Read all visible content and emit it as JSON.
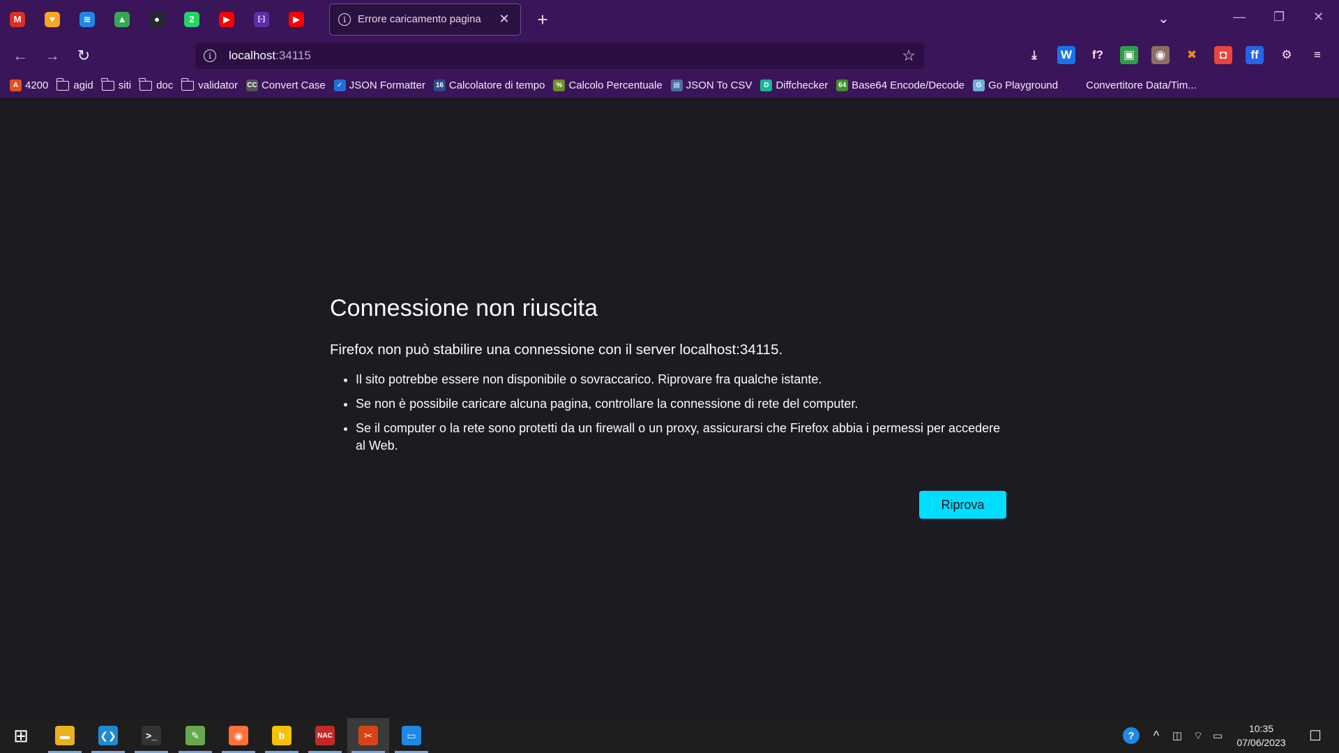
{
  "browser": {
    "pinned_tabs": [
      {
        "name": "gmail-icon",
        "glyph": "M",
        "color": "#d93025"
      },
      {
        "name": "shield-fox-icon",
        "glyph": "♥",
        "color": "#f5a623"
      },
      {
        "name": "layers-icon",
        "glyph": "≋",
        "color": "#1e88e5"
      },
      {
        "name": "drive-icon",
        "glyph": "▲",
        "color": "#34a853"
      },
      {
        "name": "github-icon",
        "glyph": "●",
        "color": "#24292f"
      },
      {
        "name": "whatsapp-icon",
        "glyph": "2",
        "color": "#25d366"
      },
      {
        "name": "youtube-icon",
        "glyph": "▶",
        "color": "#ff0000"
      },
      {
        "name": "brackets-icon",
        "glyph": "[-]",
        "color": "#5b2ea6"
      },
      {
        "name": "youtube-icon",
        "glyph": "▶",
        "color": "#ff0000"
      }
    ],
    "active_tab": {
      "title": "Errore caricamento pagina",
      "close": "✕"
    },
    "new_tab": "+",
    "tabs_list": "⌄",
    "window_controls": {
      "minimize": "—",
      "restore": "❐",
      "close": "✕"
    },
    "nav": {
      "back": "←",
      "forward": "→",
      "reload": "↻"
    },
    "url": {
      "host": "localhost",
      "port": ":34115",
      "bookmark_star": "☆"
    },
    "toolbar_icons": [
      {
        "name": "download-icon",
        "glyph": "⤓",
        "color": "transparent",
        "fg": "#efe6f6"
      },
      {
        "name": "w-extension-icon",
        "glyph": "W",
        "color": "#1a73e8",
        "fg": "#ffffff"
      },
      {
        "name": "font-extension-icon",
        "glyph": "f?",
        "color": "transparent",
        "fg": "#efe6f6"
      },
      {
        "name": "green-extension-icon",
        "glyph": "▣",
        "color": "#2e9d45",
        "fg": "#ffffff"
      },
      {
        "name": "owl-extension-icon",
        "glyph": "◉",
        "color": "#8d6e63",
        "fg": "#ffffff"
      },
      {
        "name": "cross-extension-icon",
        "glyph": "✖",
        "color": "transparent",
        "fg": "#f08a24"
      },
      {
        "name": "camera-extension-icon",
        "glyph": "◘",
        "color": "#e8453c",
        "fg": "#ffffff"
      },
      {
        "name": "ff-extension-icon",
        "glyph": "ff",
        "color": "#2563eb",
        "fg": "#ffffff"
      },
      {
        "name": "extensions-icon",
        "glyph": "⚙",
        "color": "transparent",
        "fg": "#efe6f6"
      },
      {
        "name": "menu-icon",
        "glyph": "≡",
        "color": "transparent",
        "fg": "#efe6f6"
      }
    ],
    "bookmarks": [
      {
        "label": "4200",
        "type": "site",
        "glyph": "A",
        "color": "#e0531f"
      },
      {
        "label": "agid",
        "type": "folder"
      },
      {
        "label": "siti",
        "type": "folder"
      },
      {
        "label": "doc",
        "type": "folder"
      },
      {
        "label": "validator",
        "type": "folder"
      },
      {
        "label": "Convert Case",
        "type": "site",
        "glyph": "CC",
        "color": "#555555"
      },
      {
        "label": "JSON Formatter",
        "type": "site",
        "glyph": "✓",
        "color": "#1e6fd9"
      },
      {
        "label": "Calcolatore di tempo",
        "type": "site",
        "glyph": "16",
        "color": "#2b4c8c"
      },
      {
        "label": "Calcolo Percentuale",
        "type": "site",
        "glyph": "%",
        "color": "#6b8e23"
      },
      {
        "label": "JSON To CSV",
        "type": "site",
        "glyph": "▤",
        "color": "#4a6fa5"
      },
      {
        "label": "Diffchecker",
        "type": "site",
        "glyph": "D",
        "color": "#19b59a"
      },
      {
        "label": "Base64 Encode/Decode",
        "type": "site",
        "glyph": "64",
        "color": "#3f8f2a"
      },
      {
        "label": "Go Playground",
        "type": "site",
        "glyph": "G",
        "color": "#6fb0d8"
      },
      {
        "label": "Convertitore Data/Tim...",
        "type": "text"
      }
    ]
  },
  "error_page": {
    "title": "Connessione non riuscita",
    "description": "Firefox non può stabilire una connessione con il server localhost:34115.",
    "bullets": [
      "Il sito potrebbe essere non disponibile o sovraccarico. Riprovare fra qualche istante.",
      "Se non è possibile caricare alcuna pagina, controllare la connessione di rete del computer.",
      "Se il computer o la rete sono protetti da un firewall o un proxy, assicurarsi che Firefox abbia i permessi per accedere al Web."
    ],
    "retry_label": "Riprova"
  },
  "taskbar": {
    "apps": [
      {
        "name": "windows-start-icon",
        "glyph": "⊞",
        "color": "transparent"
      },
      {
        "name": "file-explorer-icon",
        "glyph": "▬",
        "color": "#e8b21f"
      },
      {
        "name": "vscode-icon",
        "glyph": "❮❯",
        "color": "#1f8ad2"
      },
      {
        "name": "terminal-icon",
        "glyph": ">_",
        "color": "#333333"
      },
      {
        "name": "notepad-plus-icon",
        "glyph": "✎",
        "color": "#6aa84f"
      },
      {
        "name": "firefox-icon",
        "glyph": "◉",
        "color": "#ff7139"
      },
      {
        "name": "b-app-icon",
        "glyph": "b",
        "color": "#f5c400"
      },
      {
        "name": "nac-app-icon",
        "glyph": "NAC",
        "color": "#c62828"
      },
      {
        "name": "snipping-tool-icon",
        "glyph": "✂",
        "color": "#d84315"
      },
      {
        "name": "window-app-icon",
        "glyph": "▭",
        "color": "#1e88e5"
      }
    ],
    "tray": {
      "help": "?",
      "chevron": "^",
      "meet": "◫",
      "wifi": "⌔",
      "battery": "▭",
      "time": "10:35",
      "date": "07/06/2023",
      "notifications": "☐"
    }
  }
}
